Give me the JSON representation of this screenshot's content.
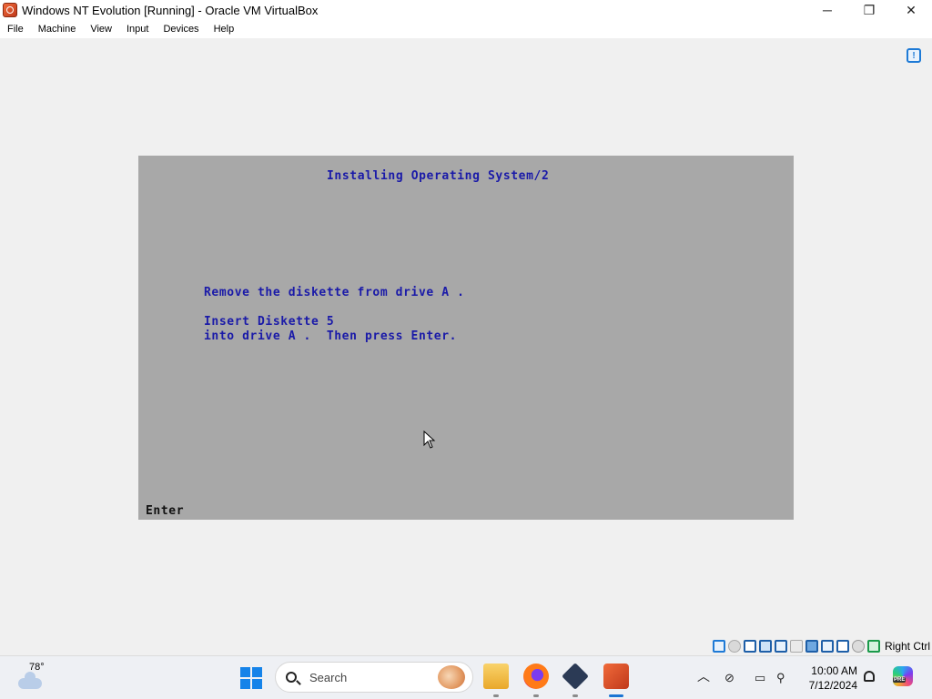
{
  "window": {
    "title": "Windows NT Evolution [Running] - Oracle VM VirtualBox",
    "controls": {
      "minimize": "─",
      "maximize": "❐",
      "close": "✕"
    }
  },
  "menu": {
    "items": [
      "File",
      "Machine",
      "View",
      "Input",
      "Devices",
      "Help"
    ]
  },
  "vm_screen": {
    "title": "Installing Operating System/2",
    "line1": "Remove the diskette from drive A .",
    "line2": "Insert Diskette 5",
    "line3": "into drive A .  Then press Enter.",
    "status": "Enter",
    "background_color": "#a8a8a8",
    "text_color": "#1a1aa8"
  },
  "vbox_status": {
    "icons": [
      "optical-drive-icon",
      "audio-icon",
      "floppy-icon",
      "usb-icon",
      "network-icon",
      "shared-folder-icon",
      "display-icon",
      "recording-icon",
      "virtualization-icon",
      "mouse-integration-icon",
      "host-key-icon"
    ],
    "host_key": "Right Ctrl"
  },
  "taskbar": {
    "weather_temp": "78°",
    "search_placeholder": "Search",
    "apps": [
      "file-explorer",
      "firefox",
      "virtualbox",
      "virtualbox-vm"
    ],
    "clock_time": "10:00 AM",
    "clock_date": "7/12/2024",
    "accent_color": "#1a74d3"
  }
}
